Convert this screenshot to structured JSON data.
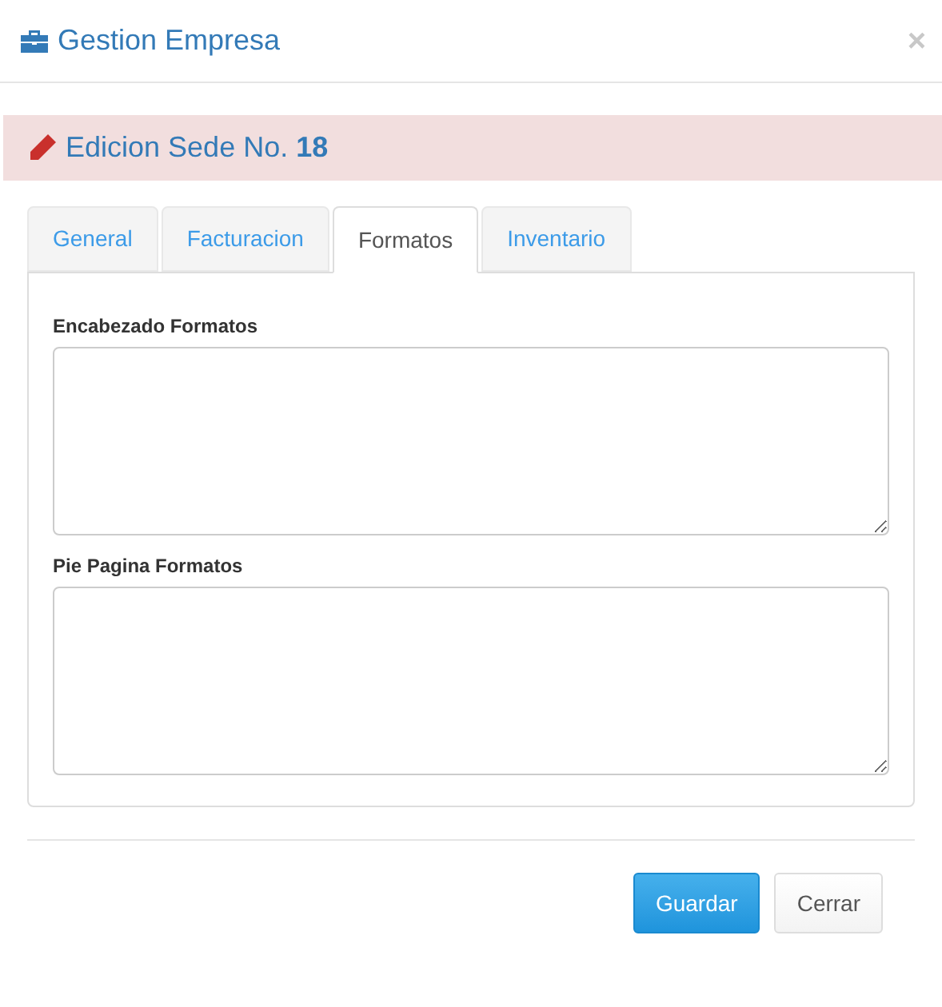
{
  "window": {
    "title": "Gestion Empresa",
    "close": "×"
  },
  "alert": {
    "text": "Edicion Sede No. **18**"
  },
  "tabs": [
    {
      "label": "General",
      "selected": false
    },
    {
      "label": "Facturacion",
      "selected": false
    },
    {
      "label": "Formatos",
      "selected": true
    },
    {
      "label": "Inventario",
      "selected": false
    }
  ],
  "fields": [
    {
      "label": "Encabezado Formatos"
    },
    {
      "label": "Pie Pagina Formatos"
    }
  ],
  "buttons": [
    {
      "label": "Guardar",
      "kind": "primary"
    },
    {
      "label": "Cerrar",
      "kind": "default"
    }
  ]
}
